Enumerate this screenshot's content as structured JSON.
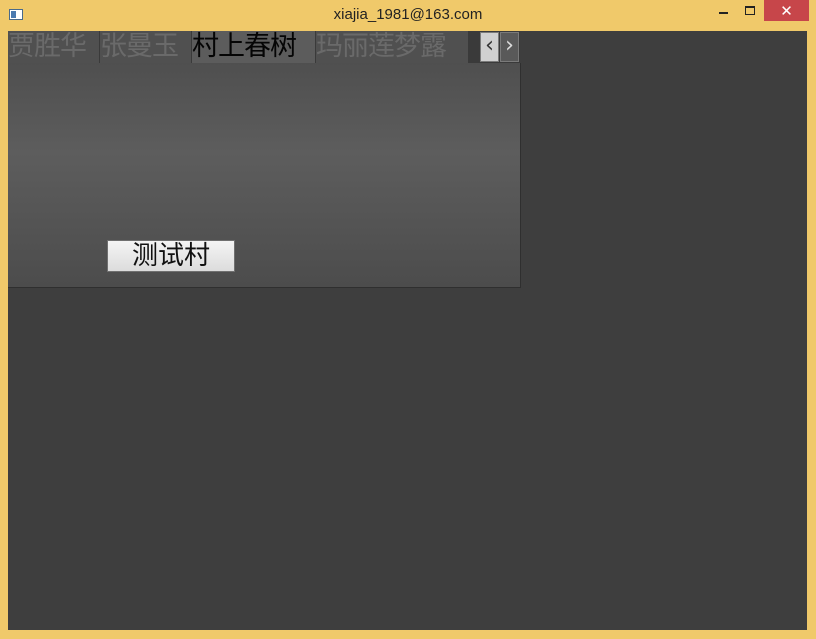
{
  "window": {
    "title": "xiajia_1981@163.com",
    "close_glyph": "✕"
  },
  "tabs": [
    {
      "label": "贾胜华",
      "active": false
    },
    {
      "label": "张曼玉",
      "active": false
    },
    {
      "label": "村上春树",
      "active": true
    },
    {
      "label": "玛丽莲梦露",
      "active": false
    }
  ],
  "tab_scroll": {
    "left_glyph": "‹",
    "right_glyph": "›"
  },
  "pane": {
    "button_label": "测试村"
  },
  "colors": {
    "frame": "#f0c96a",
    "client_bg": "#3e3e3e",
    "close_button": "#c7464a"
  }
}
